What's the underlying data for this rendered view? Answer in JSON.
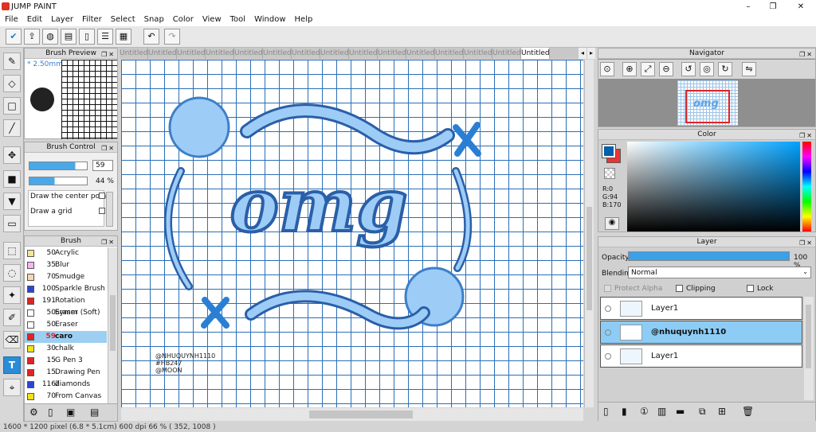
{
  "app": {
    "title": "JUMP PAINT"
  },
  "menu": [
    "File",
    "Edit",
    "Layer",
    "Filter",
    "Select",
    "Snap",
    "Color",
    "View",
    "Tool",
    "Window",
    "Help"
  ],
  "panels": {
    "brush_preview": "Brush Preview",
    "brush_control": "Brush Control",
    "brush": "Brush",
    "navigator": "Navigator",
    "color": "Color",
    "layer": "Layer"
  },
  "brush_preview": {
    "size": "* 2.50mm"
  },
  "brush_control": {
    "size_value": "59",
    "opacity_value": "44 %",
    "opt1": "Draw the center point",
    "opt2": "Draw a grid"
  },
  "brushes": [
    {
      "size": "50",
      "name": "Acrylic",
      "color": "#f1e79a"
    },
    {
      "size": "35",
      "name": "Blur",
      "color": "#f3b8ee"
    },
    {
      "size": "70",
      "name": "Smudge",
      "color": "#f6d6b3"
    },
    {
      "size": "100",
      "name": "Sparkle Brush",
      "color": "#2b44d6"
    },
    {
      "size": "191",
      "name": "Rotation Symm",
      "color": "#e02424"
    },
    {
      "size": "50",
      "name": "Eraser (Soft)",
      "color": "#ffffff"
    },
    {
      "size": "50",
      "name": "Eraser",
      "color": "#ffffff"
    },
    {
      "size": "59",
      "name": "caro",
      "color": "#e02424"
    },
    {
      "size": "30",
      "name": "chalk",
      "color": "#efe21e"
    },
    {
      "size": "15",
      "name": "G Pen 3",
      "color": "#e02424"
    },
    {
      "size": "15",
      "name": "Drawing Pen 2",
      "color": "#e02424"
    },
    {
      "size": "116",
      "name": "diamonds",
      "color": "#2b44d6"
    },
    {
      "size": "70",
      "name": "From Canvas",
      "color": "#efe21e"
    }
  ],
  "tabs": [
    "Untitled",
    "Untitled",
    "Untitled",
    "Untitled",
    "Untitled",
    "Untitled",
    "Untitled",
    "Untitled",
    "Untitled",
    "Untitled",
    "Untitled",
    "Untitled",
    "Untitled",
    "Untitled",
    "Untitled"
  ],
  "canvas": {
    "watermark": [
      "@NHUQUYNH1110",
      "#HB247",
      "@MOON"
    ]
  },
  "color": {
    "r": "R:0",
    "g": "G:94",
    "b": "B:170"
  },
  "layer": {
    "opacity_label": "Opacity",
    "opacity_value": "100 %",
    "blending_label": "Blending",
    "blending_value": "Normal",
    "protect": "Protect Alpha",
    "clipping": "Clipping",
    "lock": "Lock",
    "rows": [
      {
        "name": "Layer1"
      },
      {
        "name": "@nhuquynh1110"
      },
      {
        "name": "Layer1"
      }
    ]
  },
  "status": "1600 * 1200 pixel   (6.8 * 5.1cm)   600 dpi   66 %   ( 352, 1008 )"
}
